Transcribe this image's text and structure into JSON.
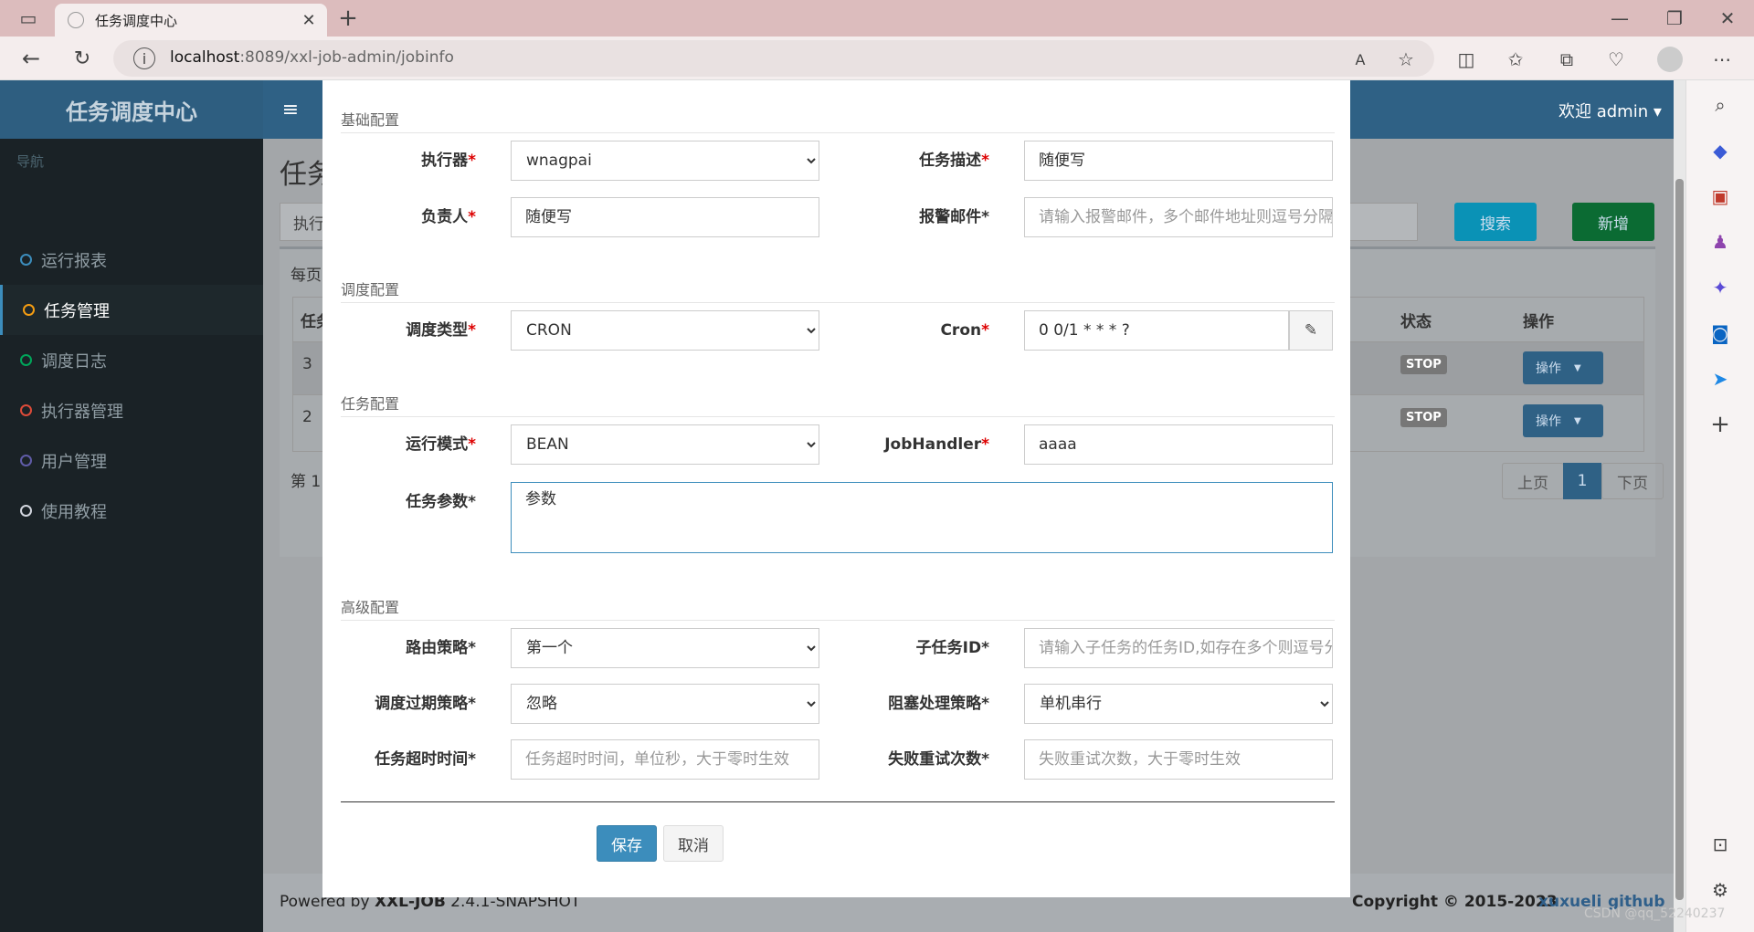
{
  "browser": {
    "tab_title": "任务调度中心",
    "url_host": "localhost",
    "url_rest": ":8089/xxl-job-admin/jobinfo"
  },
  "app": {
    "logo": "任务调度中心",
    "welcome": "欢迎 admin",
    "nav_header": "导航",
    "nav": [
      {
        "label": "运行报表",
        "color": "#3c8dbc"
      },
      {
        "label": "任务管理",
        "color": "#f39c12"
      },
      {
        "label": "调度日志",
        "color": "#00a65a"
      },
      {
        "label": "执行器管理",
        "color": "#dd4b39"
      },
      {
        "label": "用户管理",
        "color": "#605ca8"
      },
      {
        "label": "使用教程",
        "color": "#d2d6de"
      }
    ],
    "page_title_partial": "任务",
    "filter_partial": "执行",
    "search_btn": "搜索",
    "add_btn": "新增",
    "per_page_partial": "每页",
    "table": {
      "col_partial": "任务",
      "col_status": "状态",
      "col_ops": "操作",
      "rows": [
        {
          "id": "3",
          "status": "STOP",
          "op": "操作"
        },
        {
          "id": "2",
          "status": "STOP",
          "op": "操作"
        }
      ]
    },
    "page_info_partial": "第 1",
    "pager": {
      "prev": "上页",
      "current": "1",
      "next": "下页"
    },
    "footer": {
      "powered": "Powered by ",
      "brand": "XXL-JOB",
      "version": " 2.4.1-SNAPSHOT",
      "copyright": "Copyright © 2015-2023",
      "link1": "xuxueli",
      "link2": "github"
    },
    "watermark": "CSDN @qq_52240237"
  },
  "modal": {
    "sec_basic": "基础配置",
    "sec_schedule": "调度配置",
    "sec_task": "任务配置",
    "sec_advanced": "高级配置",
    "executor": {
      "label": "执行器",
      "value": "wnagpai"
    },
    "desc": {
      "label": "任务描述",
      "value": "随便写"
    },
    "owner": {
      "label": "负责人",
      "value": "随便写"
    },
    "email": {
      "label": "报警邮件*",
      "placeholder": "请输入报警邮件，多个邮件地址则逗号分隔"
    },
    "sched_type": {
      "label": "调度类型",
      "value": "CRON"
    },
    "cron": {
      "label": "Cron",
      "value": "0 0/1 * * * ?"
    },
    "run_mode": {
      "label": "运行模式",
      "value": "BEAN"
    },
    "handler": {
      "label": "JobHandler",
      "value": "aaaa"
    },
    "params": {
      "label": "任务参数*",
      "value": "参数"
    },
    "route": {
      "label": "路由策略*",
      "value": "第一个"
    },
    "child": {
      "label": "子任务ID*",
      "placeholder": "请输入子任务的任务ID,如存在多个则逗号分隔"
    },
    "misfire": {
      "label": "调度过期策略*",
      "value": "忽略"
    },
    "block": {
      "label": "阻塞处理策略*",
      "value": "单机串行"
    },
    "timeout": {
      "label": "任务超时时间*",
      "placeholder": "任务超时时间，单位秒，大于零时生效"
    },
    "retry": {
      "label": "失败重试次数*",
      "placeholder": "失败重试次数，大于零时生效"
    },
    "save": "保存",
    "cancel": "取消"
  }
}
